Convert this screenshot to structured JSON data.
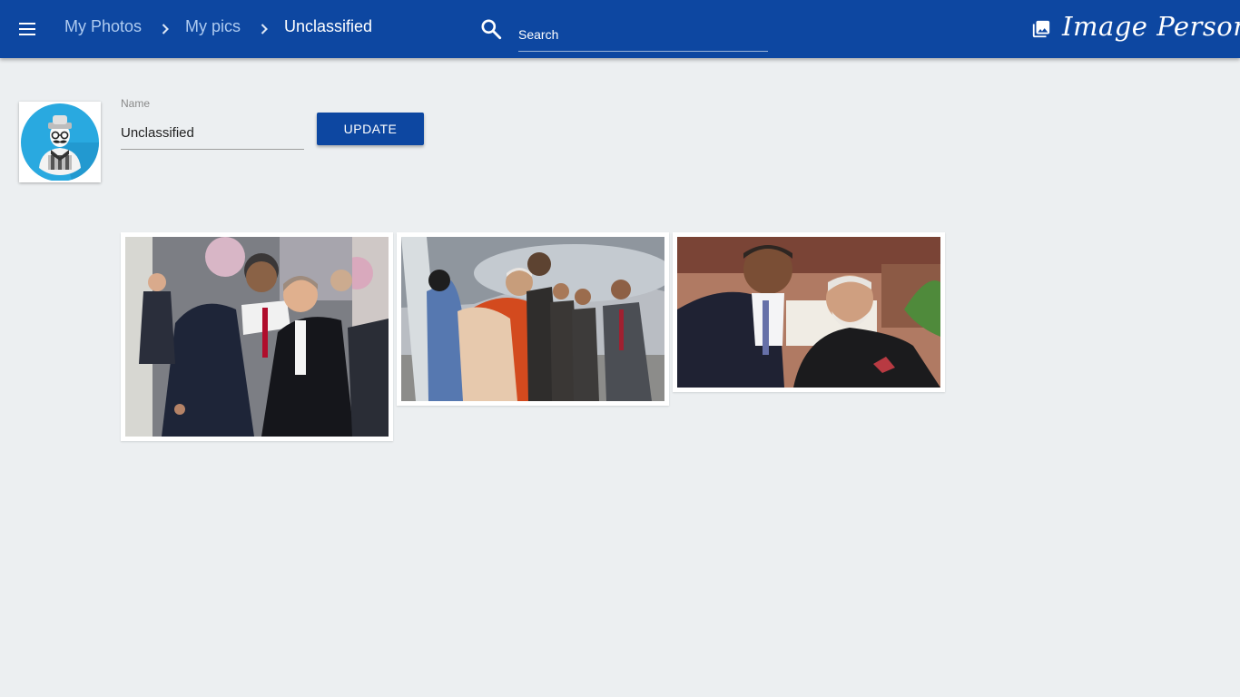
{
  "header": {
    "breadcrumb": [
      "My Photos",
      "My pics",
      "Unclassified"
    ],
    "search": {
      "placeholder": "Search",
      "value": ""
    },
    "brand": "Image Persona"
  },
  "persona": {
    "name_label": "Name",
    "name_value": "Unclassified",
    "update_label": "UPDATE"
  },
  "photos": [
    {
      "name": "photo-leaders-meeting"
    },
    {
      "name": "photo-airport-hug"
    },
    {
      "name": "photo-leaders-laughing"
    }
  ],
  "colors": {
    "header": "#0d47a1",
    "background": "#eceff1",
    "button": "#0d47a1"
  },
  "icons": [
    "menu-icon",
    "chevron-right-icon",
    "search-icon",
    "photo-library-icon"
  ]
}
